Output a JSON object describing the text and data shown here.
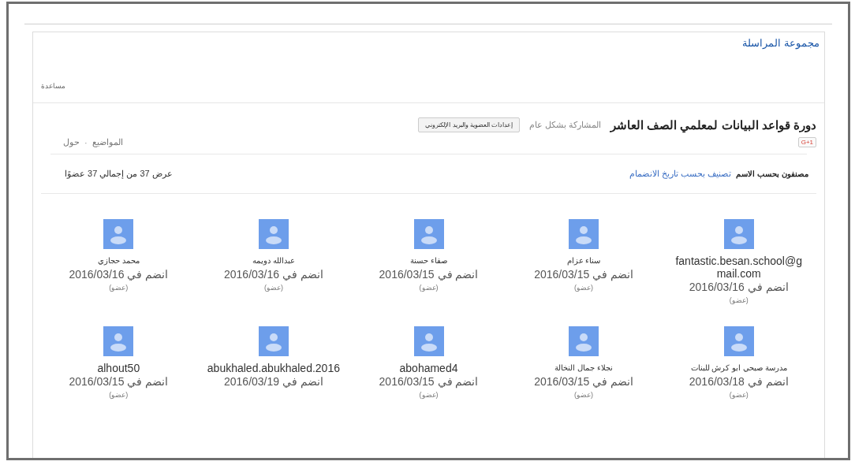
{
  "header": {
    "title": "مجموعة المراسلة",
    "help": "مساعدة"
  },
  "group": {
    "name": "دورة قواعد البيانات لمعلمي الصف العاشر",
    "visibility": "المشاركة بشكل عام",
    "settings_button": "إعدادات العضوية والبريد الإلكتروني",
    "plus_badge": "G+1",
    "nav_links": [
      "المواضيع",
      "حول"
    ],
    "nav_separator": "·"
  },
  "sort": {
    "current": "مصنفون بحسب الاسم",
    "alternative": "تصنيف بحسب تاريخ الانضمام",
    "count": "عرض 37 من إجمالي 37 عضوًا"
  },
  "members": [
    {
      "name": "fantastic.besan.school@gmail.com",
      "joined": "انضم في 2016/03/16",
      "role": "(عضو)"
    },
    {
      "name": "سناء عزام",
      "joined": "انضم في 2016/03/15",
      "role": "(عضو)"
    },
    {
      "name": "صفاء حسنة",
      "joined": "انضم في 2016/03/15",
      "role": "(عضو)"
    },
    {
      "name": "عبدالله دويمه",
      "joined": "انضم في 2016/03/16",
      "role": "(عضو)"
    },
    {
      "name": "محمد حجازي",
      "joined": "انضم في 2016/03/16",
      "role": "(عضو)"
    },
    {
      "name": "مدرسة صبحي ابو كرش للبنات",
      "joined": "انضم في 2016/03/18",
      "role": "(عضو)"
    },
    {
      "name": "نجلاء جمال النخالة",
      "joined": "انضم في 2016/03/15",
      "role": "(عضو)"
    },
    {
      "name": "abohamed4",
      "joined": "انضم في 2016/03/15",
      "role": "(عضو)"
    },
    {
      "name": "abukhaled.abukhaled.2016",
      "joined": "انضم في 2016/03/19"
    },
    {
      "name": "alhout50",
      "joined": "انضم في 2016/03/15",
      "role": "(عضو)"
    }
  ]
}
